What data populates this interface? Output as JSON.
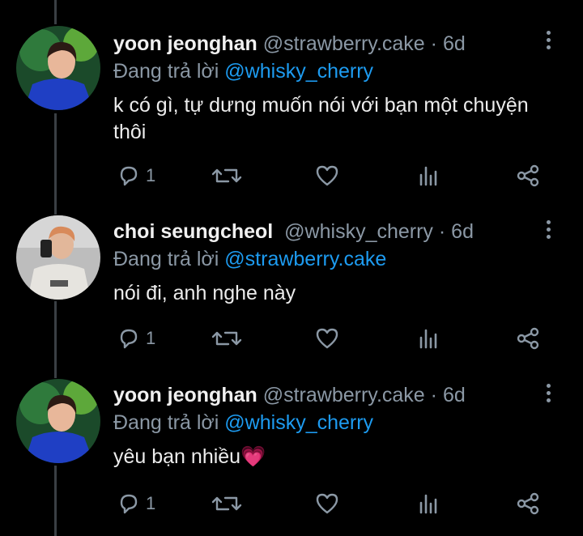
{
  "tweets": [
    {
      "name": "yoon jeonghan",
      "handle": "@strawberry.cake",
      "time": "6d",
      "reply_prefix": "Đang trả lời",
      "reply_to": "@whisky_cherry",
      "text": "k có gì, tự dưng muốn nói với bạn một chuyện thôi",
      "reply_count": "1"
    },
    {
      "name": "choi seungcheol",
      "handle": "@whisky_cherry",
      "time": "6d",
      "reply_prefix": "Đang trả lời",
      "reply_to": "@strawberry.cake",
      "text": "nói đi, anh nghe này",
      "reply_count": "1"
    },
    {
      "name": "yoon jeonghan",
      "handle": "@strawberry.cake",
      "time": "6d",
      "reply_prefix": "Đang trả lời",
      "reply_to": "@whisky_cherry",
      "text": "yêu bạn nhiều💗",
      "reply_count": "1"
    }
  ],
  "separator": "·",
  "icons": [
    "reply-icon",
    "retweet-icon",
    "like-icon",
    "analytics-icon",
    "share-icon",
    "more-icon"
  ],
  "colors": {
    "background": "#000000",
    "mention": "#1d9bf0",
    "muted": "#8b98a5"
  }
}
